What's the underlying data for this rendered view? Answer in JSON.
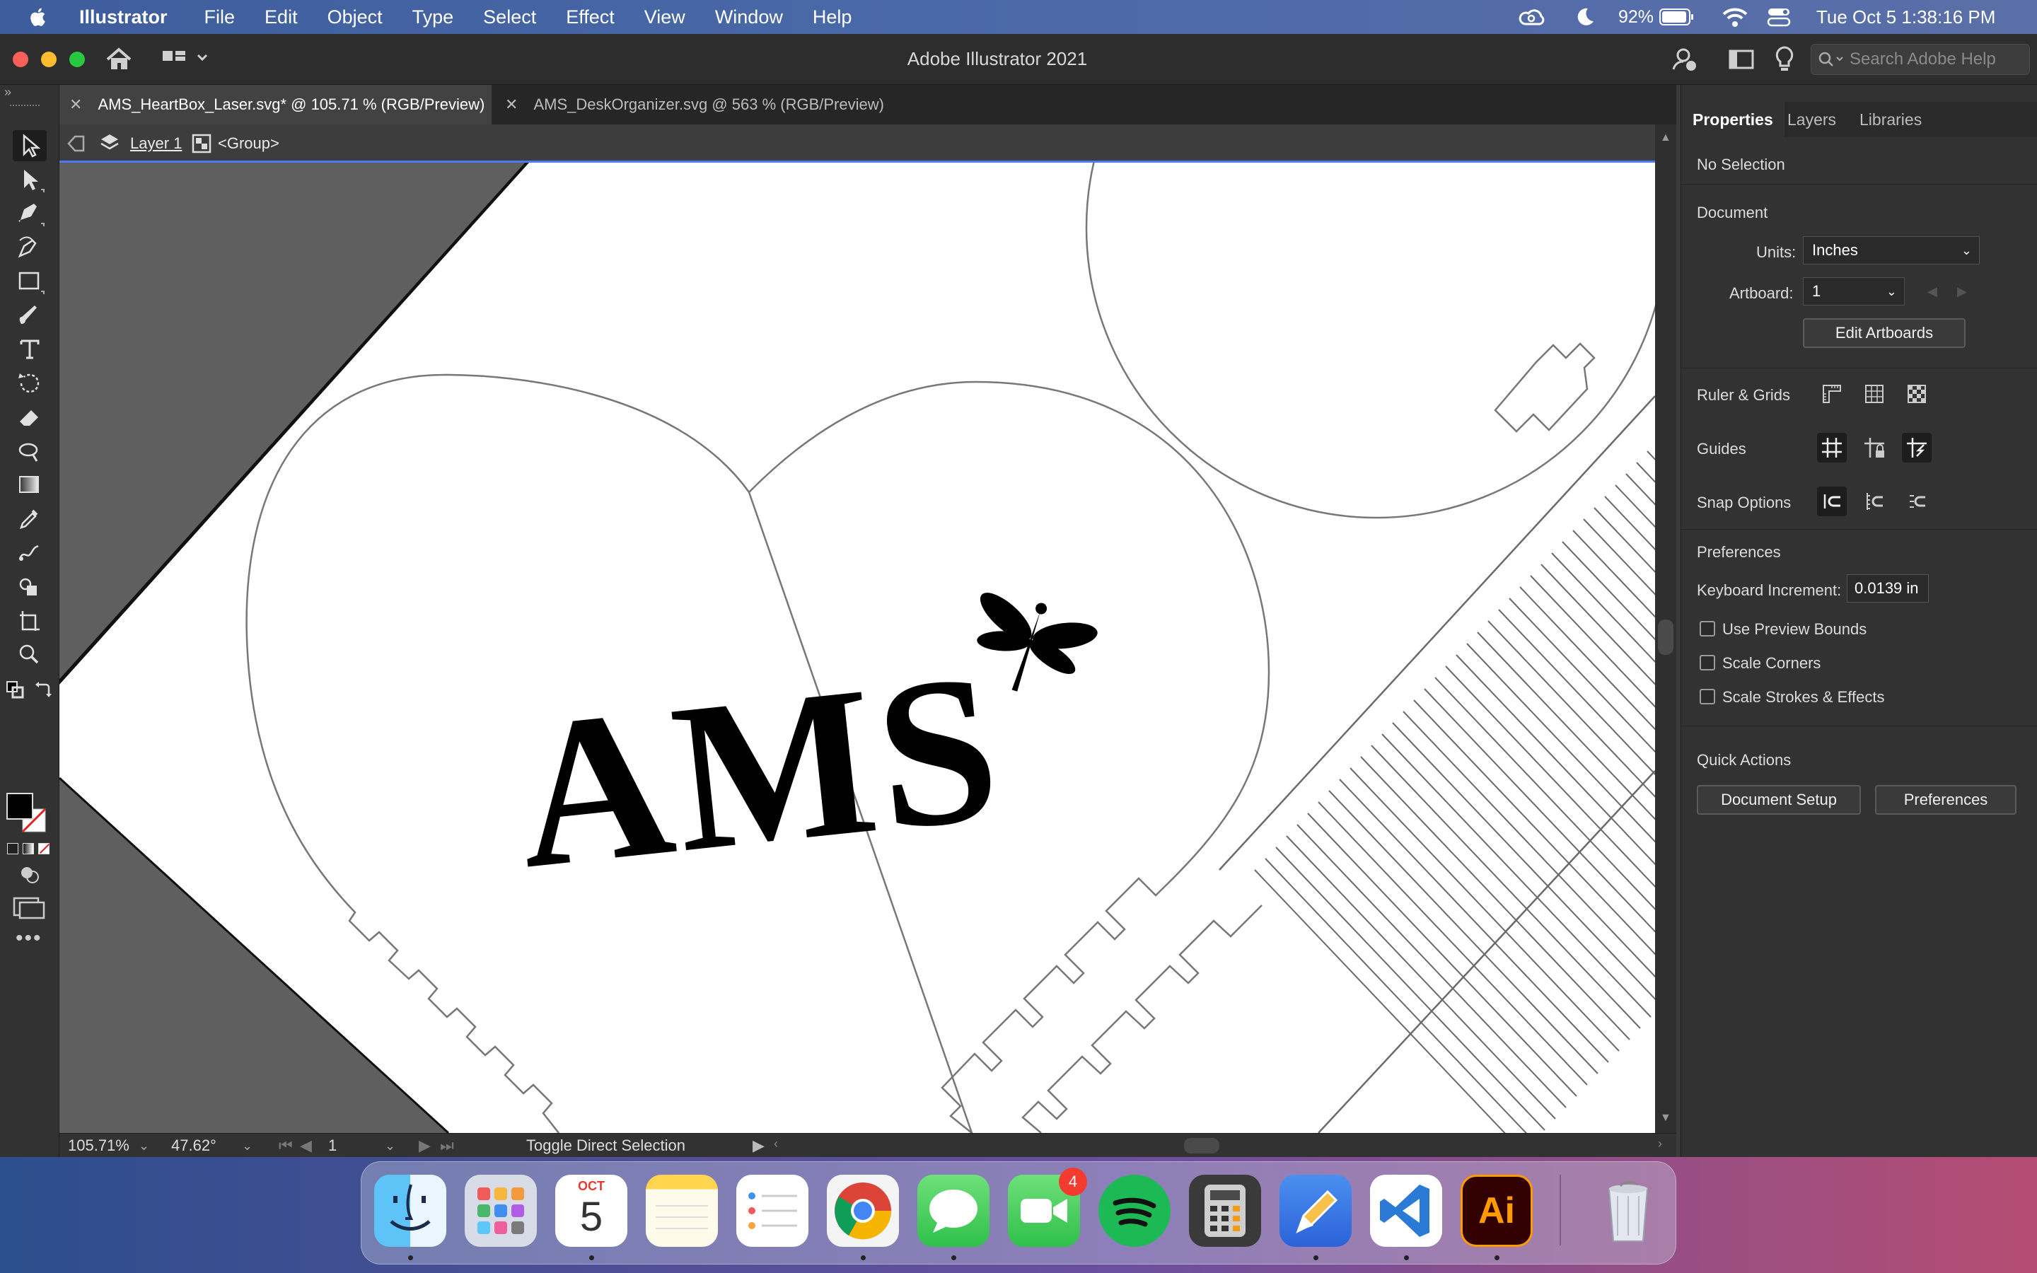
{
  "menubar": {
    "app_name": "Illustrator",
    "items": [
      "File",
      "Edit",
      "Object",
      "Type",
      "Select",
      "Effect",
      "View",
      "Window",
      "Help"
    ],
    "battery": "92%",
    "clock": "Tue Oct 5  1:38:16 PM"
  },
  "window": {
    "title": "Adobe Illustrator 2021",
    "help_search_placeholder": "Search Adobe Help"
  },
  "tabs": [
    {
      "label": "AMS_HeartBox_Laser.svg* @ 105.71 % (RGB/Preview)",
      "active": true
    },
    {
      "label": "AMS_DeskOrganizer.svg @ 563 % (RGB/Preview)",
      "active": false
    }
  ],
  "isolation": {
    "layer": "Layer 1",
    "group": "<Group>"
  },
  "artwork": {
    "text": "AMS"
  },
  "statusbar": {
    "zoom": "105.71%",
    "rotation": "47.62°",
    "artboard": "1",
    "status_text": "Toggle Direct Selection"
  },
  "panel": {
    "tabs": [
      "Properties",
      "Layers",
      "Libraries"
    ],
    "selection": "No Selection",
    "document_heading": "Document",
    "units_label": "Units:",
    "units_value": "Inches",
    "artboard_label": "Artboard:",
    "artboard_value": "1",
    "edit_artboards": "Edit Artboards",
    "ruler_grids": "Ruler & Grids",
    "guides": "Guides",
    "snap_options": "Snap Options",
    "preferences_heading": "Preferences",
    "keyboard_increment_label": "Keyboard Increment:",
    "keyboard_increment_value": "0.0139 in",
    "checkboxes": [
      {
        "label": "Use Preview Bounds",
        "checked": false
      },
      {
        "label": "Scale Corners",
        "checked": false
      },
      {
        "label": "Scale Strokes & Effects",
        "checked": false
      }
    ],
    "quick_actions_heading": "Quick Actions",
    "document_setup": "Document Setup",
    "preferences_button": "Preferences"
  },
  "dock": {
    "calendar_month": "OCT",
    "calendar_day": "5",
    "facetime_badge": "4",
    "illustrator_label": "Ai"
  },
  "colors": {
    "accent_blue": "#4a78ff",
    "illustrator_orange": "#ff9a00",
    "artboard": "#ffffff",
    "pasteboard": "#5f5f5f"
  }
}
